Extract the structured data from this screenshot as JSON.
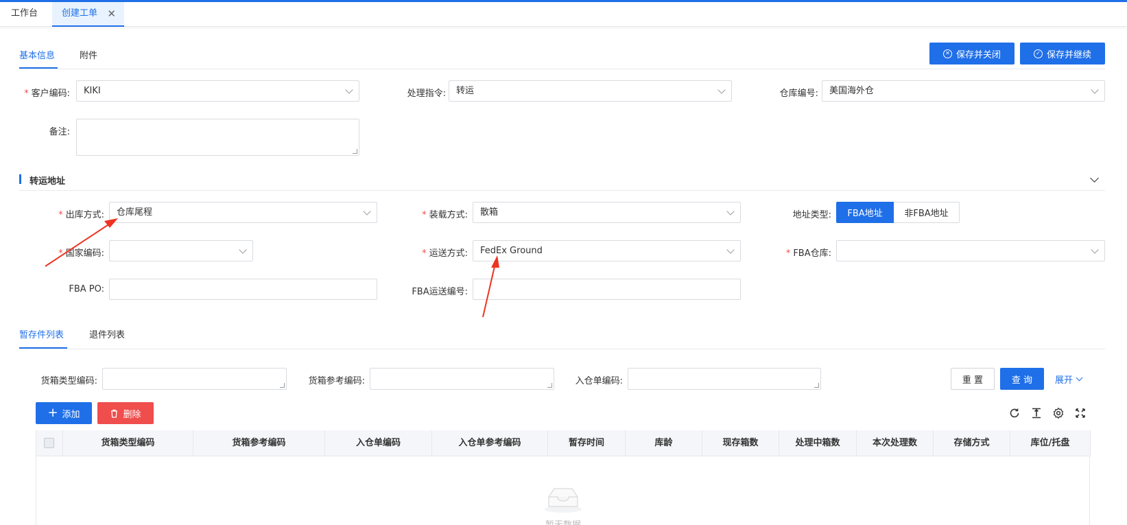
{
  "window_tabs": [
    {
      "label": "工作台"
    },
    {
      "label": "创建工单",
      "close": "✕"
    }
  ],
  "section_tabs": [
    {
      "label": "基本信息"
    },
    {
      "label": "附件"
    }
  ],
  "actions": {
    "save_close": "保存并关闭",
    "save_continue": "保存并继续"
  },
  "basic": {
    "customer_code": {
      "label": "客户编码:",
      "value": "KIKI"
    },
    "instruction": {
      "label": "处理指令:",
      "value": "转运"
    },
    "warehouse": {
      "label": "仓库编号:",
      "value": "美国海外仓"
    },
    "remark": {
      "label": "备注:"
    }
  },
  "transfer": {
    "title": "转运地址",
    "outbound_method": {
      "label": "出库方式:",
      "value": "仓库尾程"
    },
    "loading_method": {
      "label": "装载方式:",
      "value": "散箱"
    },
    "address_type": {
      "label": "地址类型:",
      "options": [
        "FBA地址",
        "非FBA地址"
      ],
      "selected": "FBA地址"
    },
    "country_code": {
      "label": "国家编码:",
      "value": ""
    },
    "shipping_method": {
      "label": "运送方式:",
      "value": "FedEx Ground"
    },
    "fba_warehouse": {
      "label": "FBA仓库:",
      "value": ""
    },
    "fba_po": {
      "label": "FBA PO:",
      "value": ""
    },
    "fba_shipping_no": {
      "label": "FBA运送编号:",
      "value": ""
    }
  },
  "list_tabs": [
    {
      "label": "暂存件列表"
    },
    {
      "label": "退件列表"
    }
  ],
  "filters": {
    "box_type_code": {
      "label": "货箱类型编码:"
    },
    "box_ref_code": {
      "label": "货箱参考编码:"
    },
    "inbound_no": {
      "label": "入仓单编码:"
    },
    "reset": "重 置",
    "query": "查 询",
    "expand": "展开"
  },
  "table_actions": {
    "add": "添加",
    "delete": "删除"
  },
  "table": {
    "columns": [
      "货箱类型编码",
      "货箱参考编码",
      "入仓单编码",
      "入仓单参考编码",
      "暂存时间",
      "库龄",
      "现存箱数",
      "处理中箱数",
      "本次处理数",
      "存储方式",
      "库位/托盘"
    ],
    "empty_text": "暂无数据"
  },
  "colors": {
    "primary": "#1f6fe8",
    "danger": "#f04d4d",
    "required": "#f04d4d",
    "annotation_arrow": "#ee3322"
  },
  "icons": [
    "close-icon",
    "close-circle-icon",
    "check-circle-icon",
    "chevron-down-icon",
    "plus-icon",
    "trash-icon",
    "refresh-icon",
    "column-height-icon",
    "settings-icon",
    "fullscreen-icon",
    "empty-inbox-icon"
  ]
}
